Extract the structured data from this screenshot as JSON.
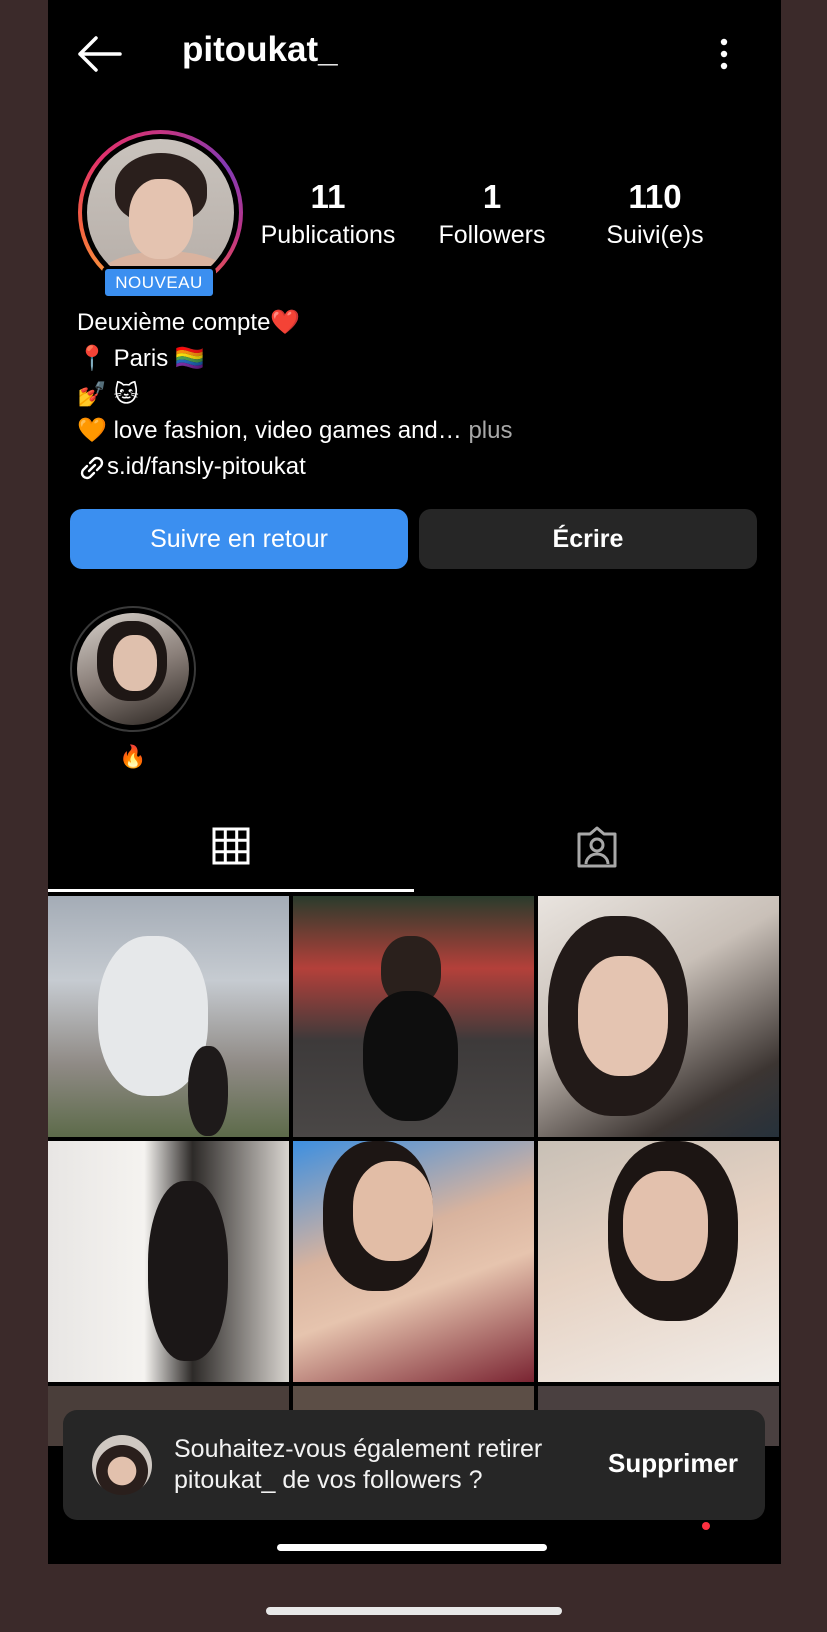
{
  "header": {
    "username": "pitoukat_"
  },
  "profile": {
    "badge": "NOUVEAU",
    "stats": [
      {
        "value": "11",
        "label": "Publications"
      },
      {
        "value": "1",
        "label": "Followers"
      },
      {
        "value": "110",
        "label": "Suivi(e)s"
      }
    ],
    "bio": {
      "line1": "Deuxième compte",
      "line1_emoji": "❤️",
      "line2_pin": "📍",
      "line2": "Paris",
      "line2_flag": "🏳️‍🌈",
      "line3_a": "💅",
      "line3_b": "🐱",
      "line4_heart": "🧡",
      "line4": "love fashion, video games and…",
      "line4_more": "plus",
      "link": "s.id/fansly-pitoukat"
    }
  },
  "actions": {
    "follow_back": "Suivre en retour",
    "write": "Écrire"
  },
  "highlight": {
    "label": "🔥"
  },
  "tabs": {
    "grid": "grid-icon",
    "tagged": "tagged-icon"
  },
  "snackbar": {
    "text": "Souhaitez-vous également retirer pitoukat_ de vos followers ?",
    "action": "Supprimer"
  },
  "colors": {
    "accent": "#3b8ff0",
    "background": "#000000",
    "button_dark": "#262626",
    "frame": "#3b2a2a"
  }
}
